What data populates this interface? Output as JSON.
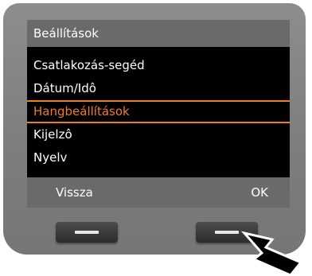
{
  "screen": {
    "title": "Beállítások",
    "menu_items": [
      {
        "label": "Csatlakozás-segéd",
        "selected": false
      },
      {
        "label": "Dátum/Idô",
        "selected": false
      },
      {
        "label": "Hangbeállítások",
        "selected": true
      },
      {
        "label": "Kijelzô",
        "selected": false
      },
      {
        "label": "Nyelv",
        "selected": false
      }
    ],
    "softkeys": {
      "left_label": "Vissza",
      "right_label": "OK"
    }
  },
  "colors": {
    "selection_accent": "#f07d1e",
    "screen_background": "#000000",
    "bar_background": "#6a6a6a",
    "device_body": "#808080"
  },
  "icons": {
    "hardware_key_left": "minus-bar-icon",
    "hardware_key_right": "minus-bar-icon",
    "pointer": "arrow-pointer-icon"
  }
}
